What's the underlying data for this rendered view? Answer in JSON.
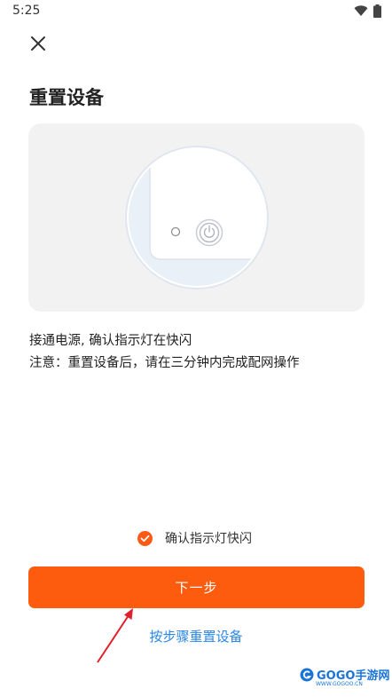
{
  "status_bar": {
    "time": "5:25",
    "icons": [
      "wifi-icon",
      "battery-icon"
    ]
  },
  "header": {
    "close_icon": "close-icon",
    "title": "重置设备"
  },
  "instructions": {
    "line1": "接通电源, 确认指示灯在快闪",
    "line2": "注意：重置设备后，请在三分钟内完成配网操作"
  },
  "confirm": {
    "label": "确认指示灯快闪",
    "checked": true
  },
  "buttons": {
    "next_label": "下一步",
    "step_link_label": "按步骤重置设备"
  },
  "watermark": {
    "text": "GOGO手游网",
    "sub": "WWW.GOGOO.CN"
  },
  "colors": {
    "accent": "#fd5c0e",
    "link": "#2a86e6",
    "illustration_bg": "#f2f2f3",
    "annotation_arrow": "#e0202a"
  }
}
